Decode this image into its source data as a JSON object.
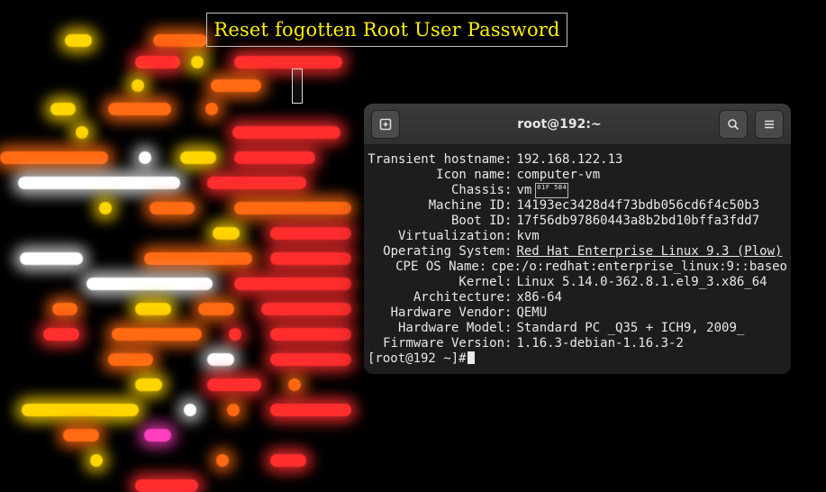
{
  "banner": {
    "title": "Reset fogotten Root User Password"
  },
  "terminal": {
    "title": "root@192:~",
    "rows": [
      {
        "label": "Transient hostname",
        "value": "192.168.122.13"
      },
      {
        "label": "Icon name",
        "value": "computer-vm"
      },
      {
        "label": "Chassis",
        "value": "vm",
        "glyph": true
      },
      {
        "label": "Machine ID",
        "value": "14193ec3428d4f73bdb056cd6f4c50b3"
      },
      {
        "label": "Boot ID",
        "value": "17f56db97860443a8b2bd10bffa3fdd7"
      },
      {
        "label": "Virtualization",
        "value": "kvm"
      },
      {
        "label": "Operating System",
        "value": "Red Hat Enterprise Linux 9.3 (Plow)",
        "underline": true
      },
      {
        "label": "CPE OS Name",
        "value": "cpe:/o:redhat:enterprise_linux:9::baseo"
      },
      {
        "label": "Kernel",
        "value": "Linux 5.14.0-362.8.1.el9_3.x86_64"
      },
      {
        "label": "Architecture",
        "value": "x86-64"
      },
      {
        "label": "Hardware Vendor",
        "value": "QEMU"
      },
      {
        "label": "Hardware Model",
        "value": "Standard PC _Q35 + ICH9, 2009_"
      },
      {
        "label": "Firmware Version",
        "value": "1.16.3-debian-1.16.3-2"
      }
    ],
    "prompt": "[root@192 ~]#",
    "chassis_glyph": "01F\n5B4"
  }
}
